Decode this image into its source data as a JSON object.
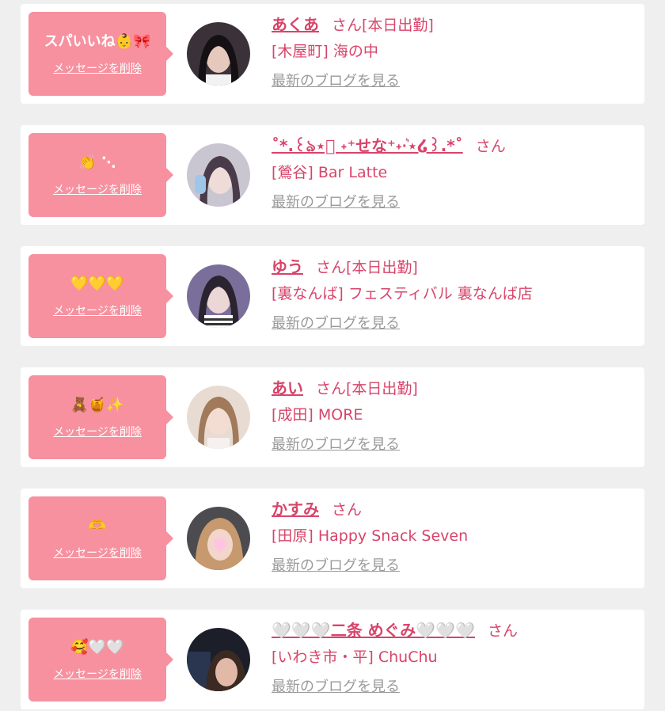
{
  "messages": [
    {
      "text": "スパいいね👶🎀",
      "delete_label": "メッセージを削除",
      "name": "あくあ",
      "honorific": "さん",
      "work_status": "[本日出勤]",
      "shop": "[木屋町] 海の中",
      "blog_label": "最新のブログを見る"
    },
    {
      "text": "👏 ⋱",
      "delete_label": "メッセージを削除",
      "name": "˚*.꒰ঌ⋆͛ ˖⁺せな⁺˖·͛⋆໒꒱.*˚",
      "honorific": "さん",
      "work_status": "",
      "shop": "[鶯谷] Bar Latte",
      "blog_label": "最新のブログを見る"
    },
    {
      "text": "💛💛💛",
      "delete_label": "メッセージを削除",
      "name": "ゆう",
      "honorific": "さん",
      "work_status": "[本日出勤]",
      "shop": "[裏なんば] フェスティバル 裏なんば店",
      "blog_label": "最新のブログを見る"
    },
    {
      "text": "🧸🍯✨",
      "delete_label": "メッセージを削除",
      "name": "あい",
      "honorific": "さん",
      "work_status": "[本日出勤]",
      "shop": "[成田] MORE",
      "blog_label": "最新のブログを見る"
    },
    {
      "text": "🫶",
      "delete_label": "メッセージを削除",
      "name": "かすみ",
      "honorific": "さん",
      "work_status": "",
      "shop": "[田原] Happy Snack Seven",
      "blog_label": "最新のブログを見る"
    },
    {
      "text": "🥰🤍🤍",
      "delete_label": "メッセージを削除",
      "name": "🤍🤍🤍二条 めぐみ🤍🤍🤍",
      "honorific": "さん",
      "work_status": "",
      "shop": "[いわき市・平] ChuChu",
      "blog_label": "最新のブログを見る"
    }
  ],
  "colors": {
    "accent": "#d8446a",
    "bubble": "#f7919f",
    "background": "#efefef",
    "link_gray": "#9a9a9a"
  }
}
